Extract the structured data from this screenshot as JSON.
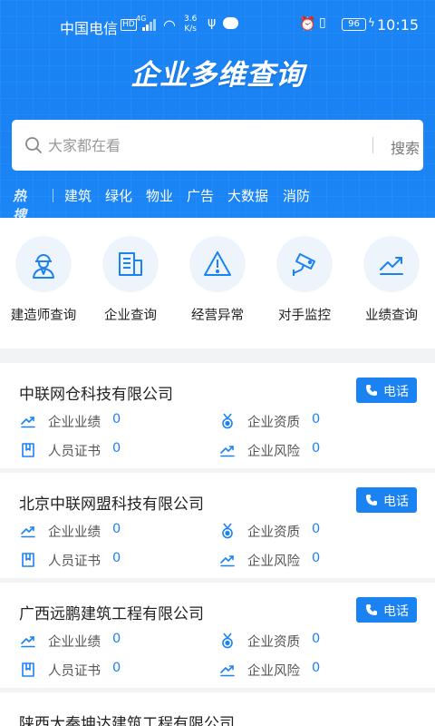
{
  "status_bar": {
    "carrier": "中国电信",
    "hd": "HD",
    "signal_type": "4G",
    "speed_value": "3.6",
    "speed_unit": "K/s",
    "battery": "96",
    "time": "10:15"
  },
  "header": {
    "title": "企业多维查询"
  },
  "search": {
    "placeholder": "大家都在看",
    "button_label": "搜索"
  },
  "hot": {
    "label": "热搜",
    "items": [
      "建筑",
      "绿化",
      "物业",
      "广告",
      "大数据",
      "消防"
    ]
  },
  "features": [
    {
      "label": "建造师查询",
      "icon": "engineer-icon"
    },
    {
      "label": "企业查询",
      "icon": "building-icon"
    },
    {
      "label": "经营异常",
      "icon": "warning-icon"
    },
    {
      "label": "对手监控",
      "icon": "camera-icon"
    },
    {
      "label": "业绩查询",
      "icon": "trend-icon"
    }
  ],
  "companies": [
    {
      "name": "中联网仓科技有限公司",
      "phone_label": "电话",
      "stats": {
        "perf_label": "企业业绩",
        "perf": "0",
        "qual_label": "企业资质",
        "qual": "0",
        "cert_label": "人员证书",
        "cert": "0",
        "risk_label": "企业风险",
        "risk": "0"
      }
    },
    {
      "name": "北京中联网盟科技有限公司",
      "phone_label": "电话",
      "stats": {
        "perf_label": "企业业绩",
        "perf": "0",
        "qual_label": "企业资质",
        "qual": "0",
        "cert_label": "人员证书",
        "cert": "0",
        "risk_label": "企业风险",
        "risk": "0"
      }
    },
    {
      "name": "广西远鹏建筑工程有限公司",
      "phone_label": "电话",
      "stats": {
        "perf_label": "企业业绩",
        "perf": "0",
        "qual_label": "企业资质",
        "qual": "0",
        "cert_label": "人员证书",
        "cert": "0",
        "risk_label": "企业风险",
        "risk": "0"
      }
    },
    {
      "name": "陕西大秦坤达建筑工程有限公司"
    }
  ],
  "colors": {
    "primary": "#1b82f2",
    "icon_bg": "#eef4fb"
  }
}
